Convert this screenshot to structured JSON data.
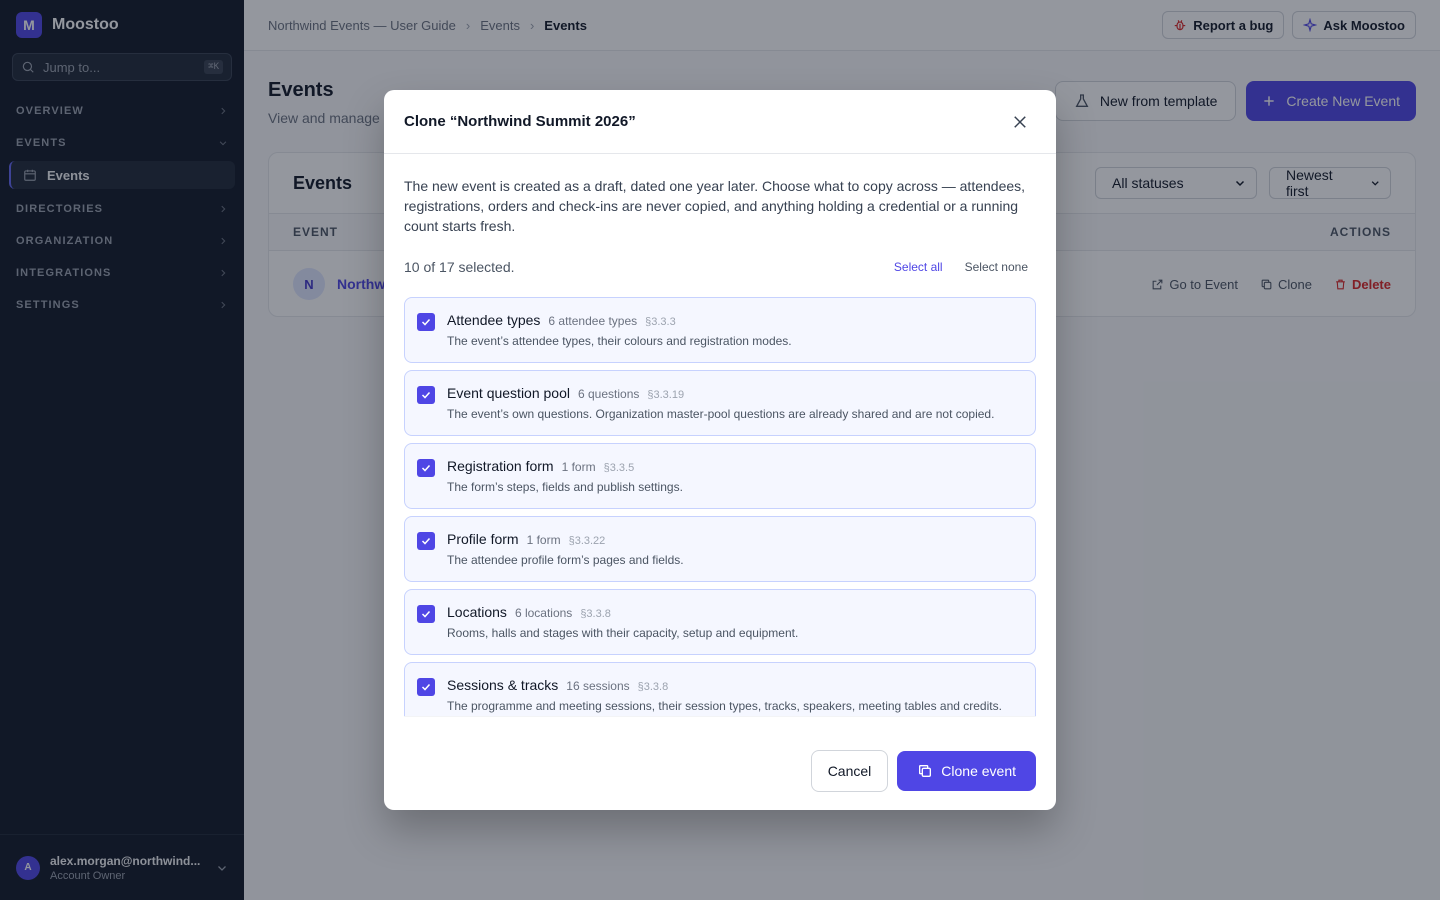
{
  "brand": {
    "initial": "M",
    "name": "Moostoo"
  },
  "search": {
    "placeholder": "Jump to...",
    "shortcut": "⌘K"
  },
  "sidebar": {
    "sections": [
      {
        "label": "OVERVIEW"
      },
      {
        "label": "EVENTS"
      },
      {
        "label": "DIRECTORIES"
      },
      {
        "label": "ORGANIZATION"
      },
      {
        "label": "INTEGRATIONS"
      },
      {
        "label": "SETTINGS"
      }
    ],
    "active_item": "Events"
  },
  "user": {
    "initial": "A",
    "email": "alex.morgan@northwind...",
    "role": "Account Owner"
  },
  "breadcrumb": [
    "Northwind Events — User Guide",
    "Events",
    "Events"
  ],
  "topbar": {
    "report_bug": "Report a bug",
    "ask": "Ask Moostoo"
  },
  "page": {
    "title": "Events",
    "subtitle": "View and manage",
    "new_from_template": "New from template",
    "create": "Create New Event"
  },
  "table": {
    "card_title": "Events",
    "status_filter": "All statuses",
    "sort": "Newest first",
    "col_event": "EVENT",
    "col_actions": "ACTIONS",
    "row": {
      "initial": "N",
      "name": "Northw",
      "go": "Go to Event",
      "clone": "Clone",
      "delete": "Delete"
    }
  },
  "modal": {
    "title": "Clone “Northwind Summit 2026”",
    "intro": "The new event is created as a draft, dated one year later. Choose what to copy across — attendees, registrations, orders and check-ins are never copied, and anything holding a credential or a running count starts fresh.",
    "selected": "10 of 17 selected.",
    "select_all": "Select all",
    "select_none": "Select none",
    "options": [
      {
        "name": "Attendee types",
        "count": "6 attendee types",
        "ref": "§3.3.3",
        "desc": "The event’s attendee types, their colours and registration modes.",
        "checked": true
      },
      {
        "name": "Event question pool",
        "count": "6 questions",
        "ref": "§3.3.19",
        "desc": "The event’s own questions. Organization master-pool questions are already shared and are not copied.",
        "checked": true
      },
      {
        "name": "Registration form",
        "count": "1 form",
        "ref": "§3.3.5",
        "desc": "The form’s steps, fields and publish settings.",
        "checked": true
      },
      {
        "name": "Profile form",
        "count": "1 form",
        "ref": "§3.3.22",
        "desc": "The attendee profile form’s pages and fields.",
        "checked": true
      },
      {
        "name": "Locations",
        "count": "6 locations",
        "ref": "§3.3.8",
        "desc": "Rooms, halls and stages with their capacity, setup and equipment.",
        "checked": true
      },
      {
        "name": "Sessions & tracks",
        "count": "16 sessions",
        "ref": "§3.3.8",
        "desc": "The programme and meeting sessions, their session types, tracks, speakers, meeting tables and credits. Dates shift onto the new event’s days.",
        "checked": true
      }
    ],
    "cancel": "Cancel",
    "confirm": "Clone event"
  }
}
